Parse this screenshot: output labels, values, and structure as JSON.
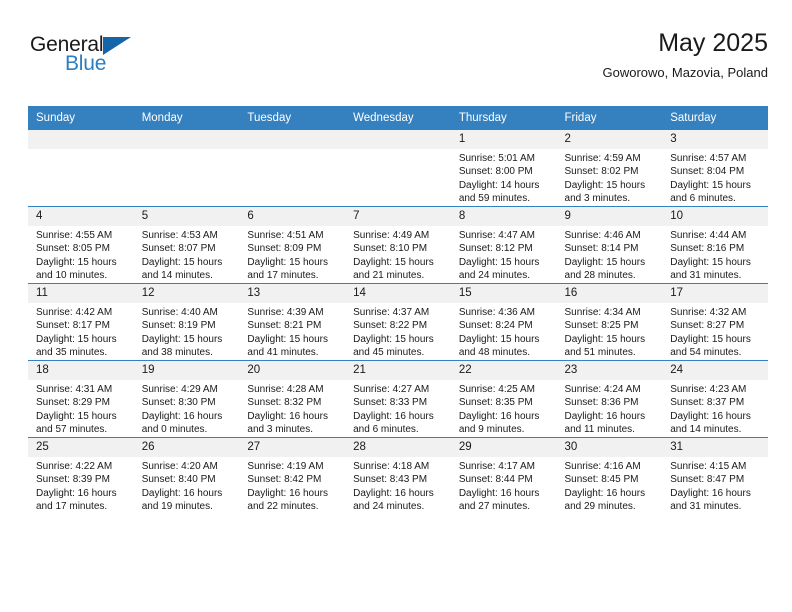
{
  "brand": {
    "name_part1": "General",
    "name_part2": "Blue",
    "logo_icon": "triangle-flag-icon",
    "accent_color": "#2b7ec1",
    "triangle_color": "#1565a8"
  },
  "header": {
    "title": "May 2025",
    "subtitle": "Goworowo, Mazovia, Poland"
  },
  "calendar": {
    "header_bg": "#3580bf",
    "daynum_bg": "#f1f1f1",
    "weekday_headers": [
      "Sunday",
      "Monday",
      "Tuesday",
      "Wednesday",
      "Thursday",
      "Friday",
      "Saturday"
    ],
    "labels": {
      "sunrise": "Sunrise:",
      "sunset": "Sunset:",
      "daylight": "Daylight:"
    },
    "weeks": [
      [
        {
          "day": "",
          "lines": []
        },
        {
          "day": "",
          "lines": []
        },
        {
          "day": "",
          "lines": []
        },
        {
          "day": "",
          "lines": []
        },
        {
          "day": "1",
          "lines": [
            "Sunrise: 5:01 AM",
            "Sunset: 8:00 PM",
            "Daylight: 14 hours",
            "and 59 minutes."
          ]
        },
        {
          "day": "2",
          "lines": [
            "Sunrise: 4:59 AM",
            "Sunset: 8:02 PM",
            "Daylight: 15 hours",
            "and 3 minutes."
          ]
        },
        {
          "day": "3",
          "lines": [
            "Sunrise: 4:57 AM",
            "Sunset: 8:04 PM",
            "Daylight: 15 hours",
            "and 6 minutes."
          ]
        }
      ],
      [
        {
          "day": "4",
          "lines": [
            "Sunrise: 4:55 AM",
            "Sunset: 8:05 PM",
            "Daylight: 15 hours",
            "and 10 minutes."
          ]
        },
        {
          "day": "5",
          "lines": [
            "Sunrise: 4:53 AM",
            "Sunset: 8:07 PM",
            "Daylight: 15 hours",
            "and 14 minutes."
          ]
        },
        {
          "day": "6",
          "lines": [
            "Sunrise: 4:51 AM",
            "Sunset: 8:09 PM",
            "Daylight: 15 hours",
            "and 17 minutes."
          ]
        },
        {
          "day": "7",
          "lines": [
            "Sunrise: 4:49 AM",
            "Sunset: 8:10 PM",
            "Daylight: 15 hours",
            "and 21 minutes."
          ]
        },
        {
          "day": "8",
          "lines": [
            "Sunrise: 4:47 AM",
            "Sunset: 8:12 PM",
            "Daylight: 15 hours",
            "and 24 minutes."
          ]
        },
        {
          "day": "9",
          "lines": [
            "Sunrise: 4:46 AM",
            "Sunset: 8:14 PM",
            "Daylight: 15 hours",
            "and 28 minutes."
          ]
        },
        {
          "day": "10",
          "lines": [
            "Sunrise: 4:44 AM",
            "Sunset: 8:16 PM",
            "Daylight: 15 hours",
            "and 31 minutes."
          ]
        }
      ],
      [
        {
          "day": "11",
          "lines": [
            "Sunrise: 4:42 AM",
            "Sunset: 8:17 PM",
            "Daylight: 15 hours",
            "and 35 minutes."
          ]
        },
        {
          "day": "12",
          "lines": [
            "Sunrise: 4:40 AM",
            "Sunset: 8:19 PM",
            "Daylight: 15 hours",
            "and 38 minutes."
          ]
        },
        {
          "day": "13",
          "lines": [
            "Sunrise: 4:39 AM",
            "Sunset: 8:21 PM",
            "Daylight: 15 hours",
            "and 41 minutes."
          ]
        },
        {
          "day": "14",
          "lines": [
            "Sunrise: 4:37 AM",
            "Sunset: 8:22 PM",
            "Daylight: 15 hours",
            "and 45 minutes."
          ]
        },
        {
          "day": "15",
          "lines": [
            "Sunrise: 4:36 AM",
            "Sunset: 8:24 PM",
            "Daylight: 15 hours",
            "and 48 minutes."
          ]
        },
        {
          "day": "16",
          "lines": [
            "Sunrise: 4:34 AM",
            "Sunset: 8:25 PM",
            "Daylight: 15 hours",
            "and 51 minutes."
          ]
        },
        {
          "day": "17",
          "lines": [
            "Sunrise: 4:32 AM",
            "Sunset: 8:27 PM",
            "Daylight: 15 hours",
            "and 54 minutes."
          ]
        }
      ],
      [
        {
          "day": "18",
          "lines": [
            "Sunrise: 4:31 AM",
            "Sunset: 8:29 PM",
            "Daylight: 15 hours",
            "and 57 minutes."
          ]
        },
        {
          "day": "19",
          "lines": [
            "Sunrise: 4:29 AM",
            "Sunset: 8:30 PM",
            "Daylight: 16 hours",
            "and 0 minutes."
          ]
        },
        {
          "day": "20",
          "lines": [
            "Sunrise: 4:28 AM",
            "Sunset: 8:32 PM",
            "Daylight: 16 hours",
            "and 3 minutes."
          ]
        },
        {
          "day": "21",
          "lines": [
            "Sunrise: 4:27 AM",
            "Sunset: 8:33 PM",
            "Daylight: 16 hours",
            "and 6 minutes."
          ]
        },
        {
          "day": "22",
          "lines": [
            "Sunrise: 4:25 AM",
            "Sunset: 8:35 PM",
            "Daylight: 16 hours",
            "and 9 minutes."
          ]
        },
        {
          "day": "23",
          "lines": [
            "Sunrise: 4:24 AM",
            "Sunset: 8:36 PM",
            "Daylight: 16 hours",
            "and 11 minutes."
          ]
        },
        {
          "day": "24",
          "lines": [
            "Sunrise: 4:23 AM",
            "Sunset: 8:37 PM",
            "Daylight: 16 hours",
            "and 14 minutes."
          ]
        }
      ],
      [
        {
          "day": "25",
          "lines": [
            "Sunrise: 4:22 AM",
            "Sunset: 8:39 PM",
            "Daylight: 16 hours",
            "and 17 minutes."
          ]
        },
        {
          "day": "26",
          "lines": [
            "Sunrise: 4:20 AM",
            "Sunset: 8:40 PM",
            "Daylight: 16 hours",
            "and 19 minutes."
          ]
        },
        {
          "day": "27",
          "lines": [
            "Sunrise: 4:19 AM",
            "Sunset: 8:42 PM",
            "Daylight: 16 hours",
            "and 22 minutes."
          ]
        },
        {
          "day": "28",
          "lines": [
            "Sunrise: 4:18 AM",
            "Sunset: 8:43 PM",
            "Daylight: 16 hours",
            "and 24 minutes."
          ]
        },
        {
          "day": "29",
          "lines": [
            "Sunrise: 4:17 AM",
            "Sunset: 8:44 PM",
            "Daylight: 16 hours",
            "and 27 minutes."
          ]
        },
        {
          "day": "30",
          "lines": [
            "Sunrise: 4:16 AM",
            "Sunset: 8:45 PM",
            "Daylight: 16 hours",
            "and 29 minutes."
          ]
        },
        {
          "day": "31",
          "lines": [
            "Sunrise: 4:15 AM",
            "Sunset: 8:47 PM",
            "Daylight: 16 hours",
            "and 31 minutes."
          ]
        }
      ]
    ]
  }
}
